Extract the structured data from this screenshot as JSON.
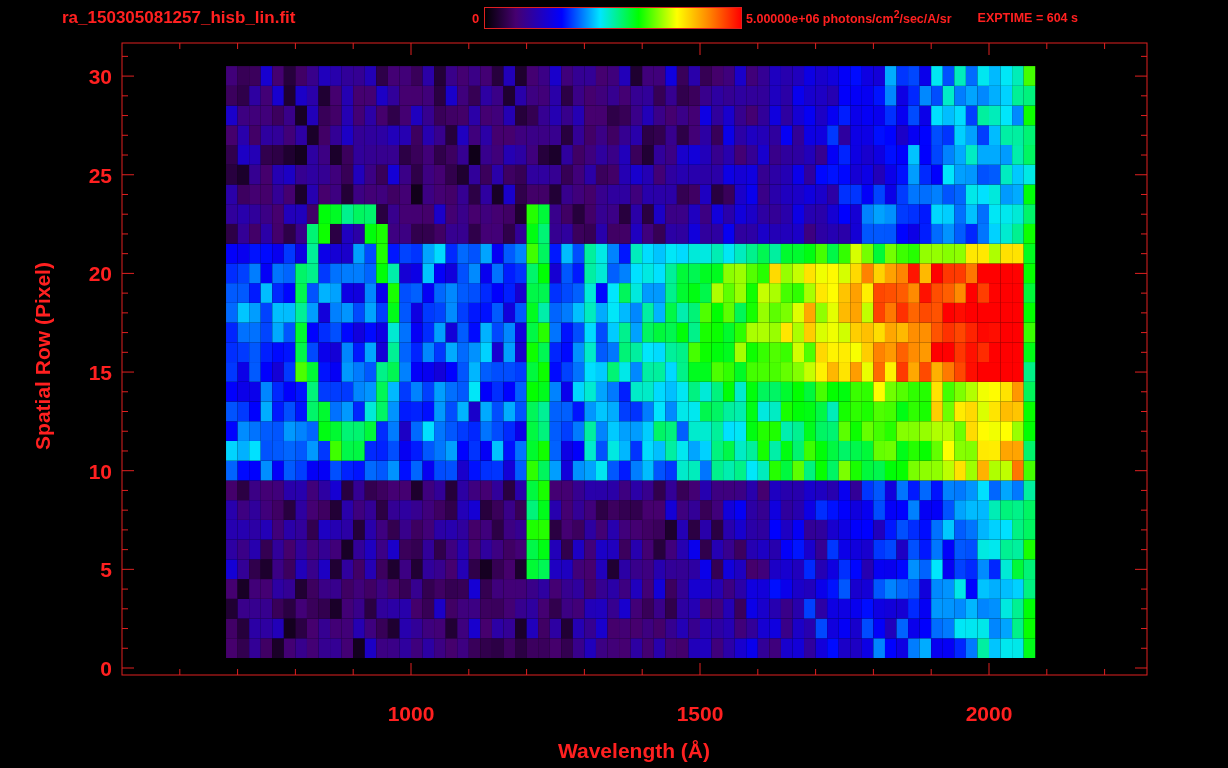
{
  "header": {
    "file_name": "ra_150305081257_hisb_lin.fit",
    "colorbar_min": "0",
    "colorbar_max": "5.00000e+06 photons/cm$^{2}$/sec/A/sr",
    "exposure": "EXPTIME = 604 s"
  },
  "plot": {
    "xlabel": "Wavelength (Å)",
    "ylabel": "Spatial Row (Pixel)",
    "xticks": [
      "1000",
      "1500",
      "2000"
    ],
    "yticks": [
      "30",
      "25",
      "20",
      "15",
      "10",
      "5",
      "0"
    ]
  }
}
